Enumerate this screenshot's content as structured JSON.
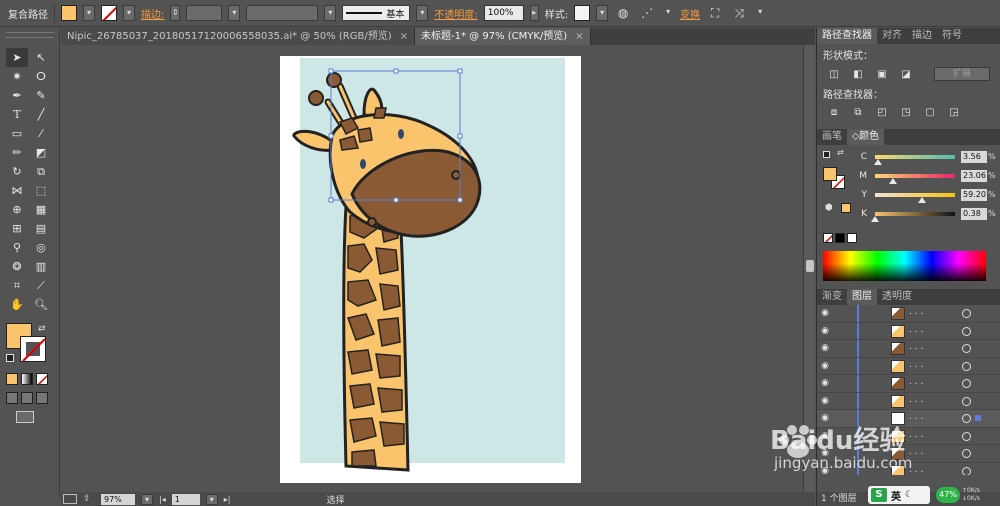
{
  "control_bar": {
    "object_type": "复合路径",
    "stroke_label": "描边:",
    "stroke_style": "基本",
    "opacity_label": "不透明度:",
    "opacity_value": "100%",
    "style_label": "样式:",
    "transform_label": "变换",
    "fill_color": "#f9c46b"
  },
  "tabs": [
    {
      "label": "Nipic_26785037_20180517120006558035.ai* @ 50% (RGB/预览)",
      "active": false
    },
    {
      "label": "未标题-1* @ 97% (CMYK/预览)",
      "active": true
    }
  ],
  "status": {
    "zoom": "97%",
    "page": "1",
    "tool": "选择"
  },
  "pathfinder": {
    "tabs": [
      "路径查找器",
      "对齐",
      "描边",
      "符号"
    ],
    "shape_modes_label": "形状模式：",
    "expand_label": "扩展",
    "pathfinders_label": "路径查找器："
  },
  "color_panel": {
    "tabs": [
      "画笔",
      "颜色"
    ],
    "fill_color": "#f9c46b",
    "sliders": [
      {
        "name": "C",
        "value": "3.56",
        "fraction": 0.04
      },
      {
        "name": "M",
        "value": "23.06",
        "fraction": 0.23
      },
      {
        "name": "Y",
        "value": "59.20",
        "fraction": 0.59
      },
      {
        "name": "K",
        "value": "0.38",
        "fraction": 0.0
      }
    ],
    "percent": "%"
  },
  "layers_panel": {
    "tabs": [
      "渐变",
      "图层",
      "透明度"
    ],
    "rows": 11,
    "dots": ". . .",
    "footer": "1 个图层"
  },
  "watermark": {
    "brand": "Baidu经验",
    "url": "jingyan.baidu.com"
  },
  "taskbar": {
    "ime": "英",
    "badge": "47%",
    "speed_up": "0K/s",
    "speed_down": "0K/s"
  }
}
